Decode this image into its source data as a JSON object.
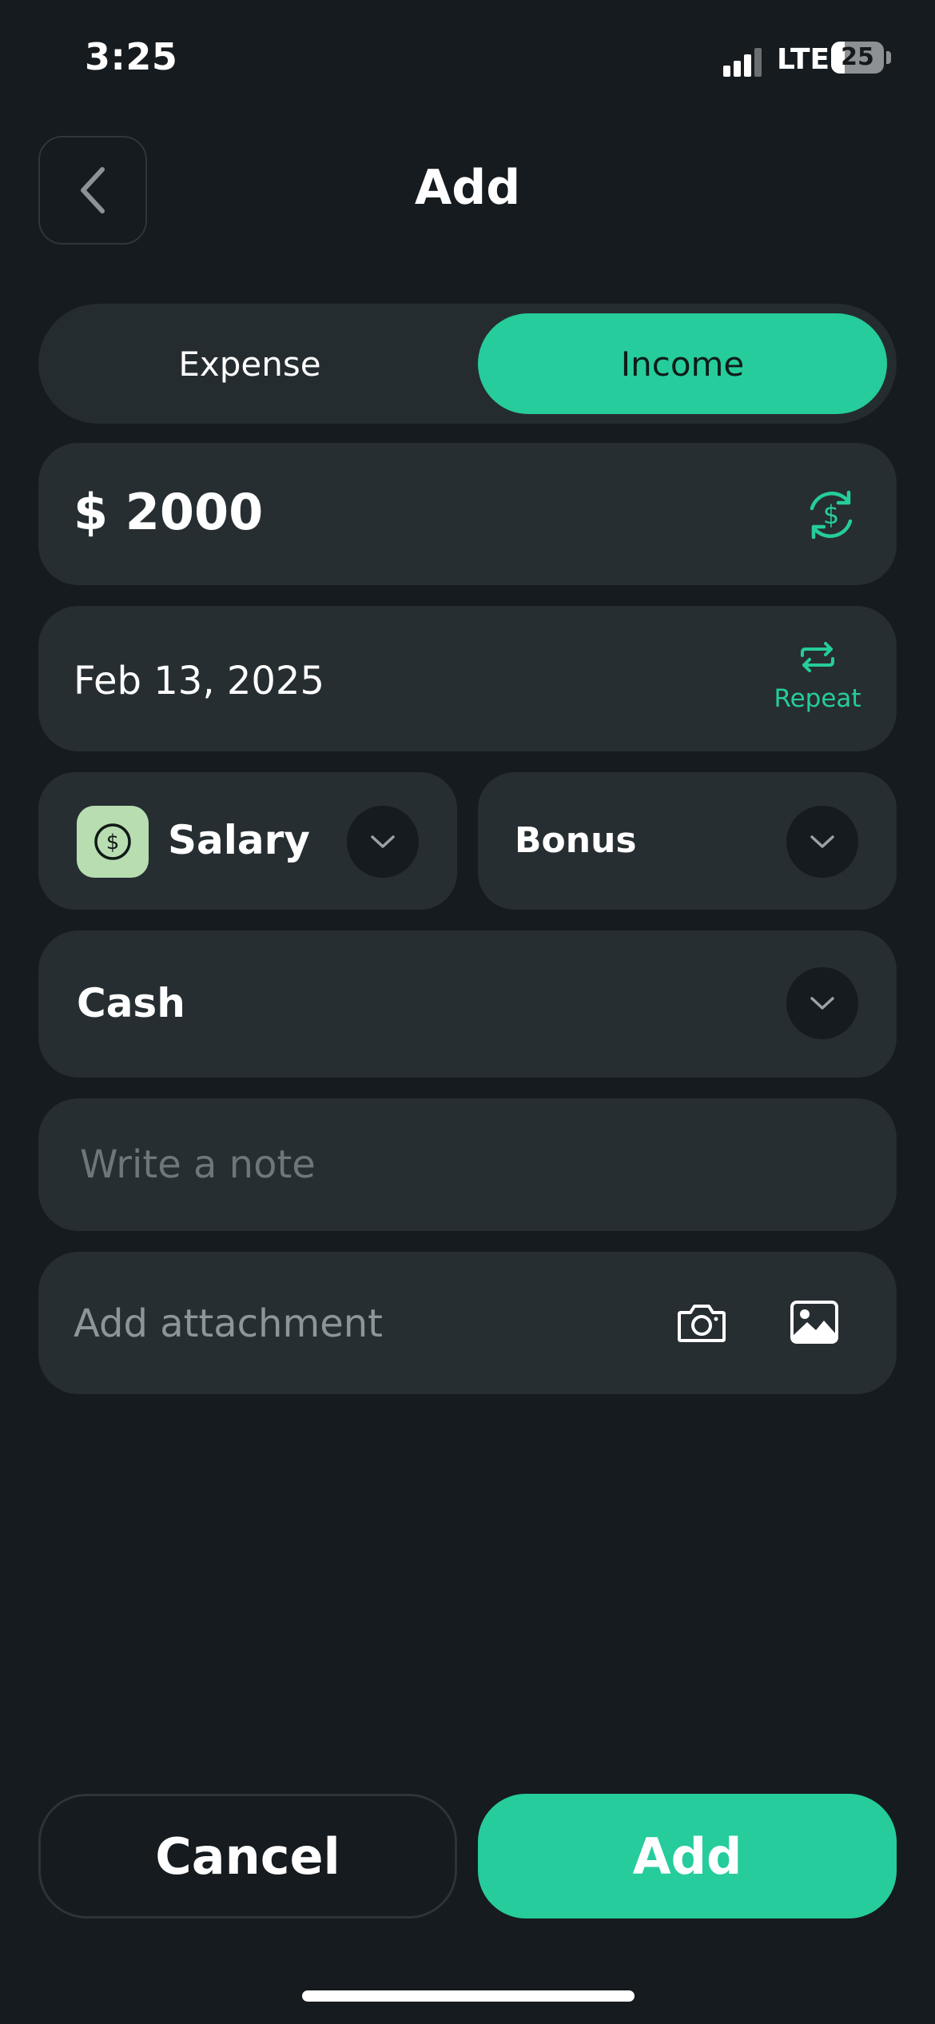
{
  "status_bar": {
    "time": "3:25",
    "network": "LTE",
    "battery": "25",
    "battery_level": 0.25
  },
  "header": {
    "title": "Add",
    "back_icon": "chevron-left-icon"
  },
  "type_toggle": {
    "options": [
      "Expense",
      "Income"
    ],
    "selected": "Income"
  },
  "amount": {
    "value": "$ 2000",
    "icon": "currency-sync-icon"
  },
  "date": {
    "value": "Feb 13, 2025",
    "repeat_label": "Repeat",
    "repeat_icon": "repeat-icon"
  },
  "category": {
    "label": "Salary",
    "icon": "dollar-circle-icon",
    "icon_bg": "#b7ddb1"
  },
  "subcategory": {
    "label": "Bonus"
  },
  "account": {
    "label": "Cash"
  },
  "note": {
    "placeholder": "Write a note",
    "value": ""
  },
  "attachment": {
    "label": "Add attachment",
    "icons": [
      "camera-icon",
      "image-icon"
    ]
  },
  "actions": {
    "cancel_label": "Cancel",
    "add_label": "Add"
  },
  "colors": {
    "accent": "#26cc9c",
    "background": "#151b1e",
    "card": "#262e32"
  }
}
